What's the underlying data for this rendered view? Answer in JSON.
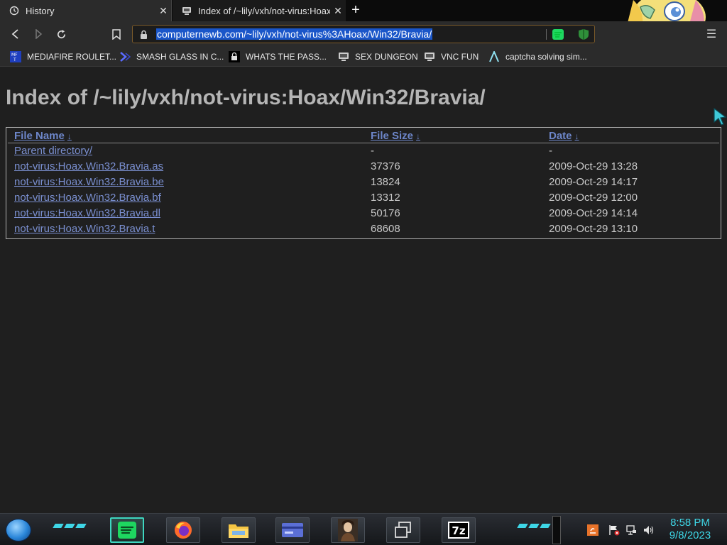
{
  "tabs": [
    {
      "title": "History",
      "icon": "history-icon",
      "close_label": "✕"
    },
    {
      "title": "Index of /~lily/vxh/not-virus:Hoax/",
      "icon": "server-icon",
      "close_label": "✕"
    }
  ],
  "new_tab_label": "+",
  "url": "computernewb.com/~lily/vxh/not-virus%3AHoax/Win32/Bravia/",
  "menu_label": "☰",
  "bookmarks": [
    {
      "label": "MEDIAFIRE ROULET...",
      "icon": "mediafire-icon"
    },
    {
      "label": "SMASH GLASS IN C...",
      "icon": "smash-glass-icon"
    },
    {
      "label": "WHATS THE PASS...",
      "icon": "lock-icon"
    },
    {
      "label": "SEX DUNGEON",
      "icon": "server-icon"
    },
    {
      "label": "VNC FUN",
      "icon": "server-icon"
    },
    {
      "label": "captcha solving sim...",
      "icon": "arrow-logo-icon"
    }
  ],
  "page": {
    "title": "Index of /~lily/vxh/not-virus:Hoax/Win32/Bravia/",
    "columns": [
      {
        "label": "File Name",
        "sort": "↓"
      },
      {
        "label": "File Size",
        "sort": "↓"
      },
      {
        "label": "Date",
        "sort": "↓"
      }
    ],
    "rows": [
      {
        "name": "Parent directory/",
        "size": "-",
        "date": "-"
      },
      {
        "name": "not-virus:Hoax.Win32.Bravia.as",
        "size": "37376",
        "date": "2009-Oct-29 13:28"
      },
      {
        "name": "not-virus:Hoax.Win32.Bravia.be",
        "size": "13824",
        "date": "2009-Oct-29 14:17"
      },
      {
        "name": "not-virus:Hoax.Win32.Bravia.bf",
        "size": "13312",
        "date": "2009-Oct-29 12:00"
      },
      {
        "name": "not-virus:Hoax.Win32.Bravia.dl",
        "size": "50176",
        "date": "2009-Oct-29 14:14"
      },
      {
        "name": "not-virus:Hoax.Win32.Bravia.t",
        "size": "68608",
        "date": "2009-Oct-29 13:10"
      }
    ]
  },
  "taskbar": {
    "apps": [
      "spotify-icon",
      "firefox-icon",
      "file-explorer-icon",
      "card-icon",
      "portrait-icon",
      "windows-icon",
      "7zip-icon"
    ],
    "sevenzip_label": "7z",
    "tray_icons": [
      "java-icon",
      "flag-icon",
      "network-icon",
      "volume-icon"
    ],
    "time": "8:58 PM",
    "date": "9/8/2023"
  },
  "colors": {
    "accent": "#3ed6e6",
    "link": "#7a8fd0",
    "url_highlight": "#1a56c9"
  }
}
